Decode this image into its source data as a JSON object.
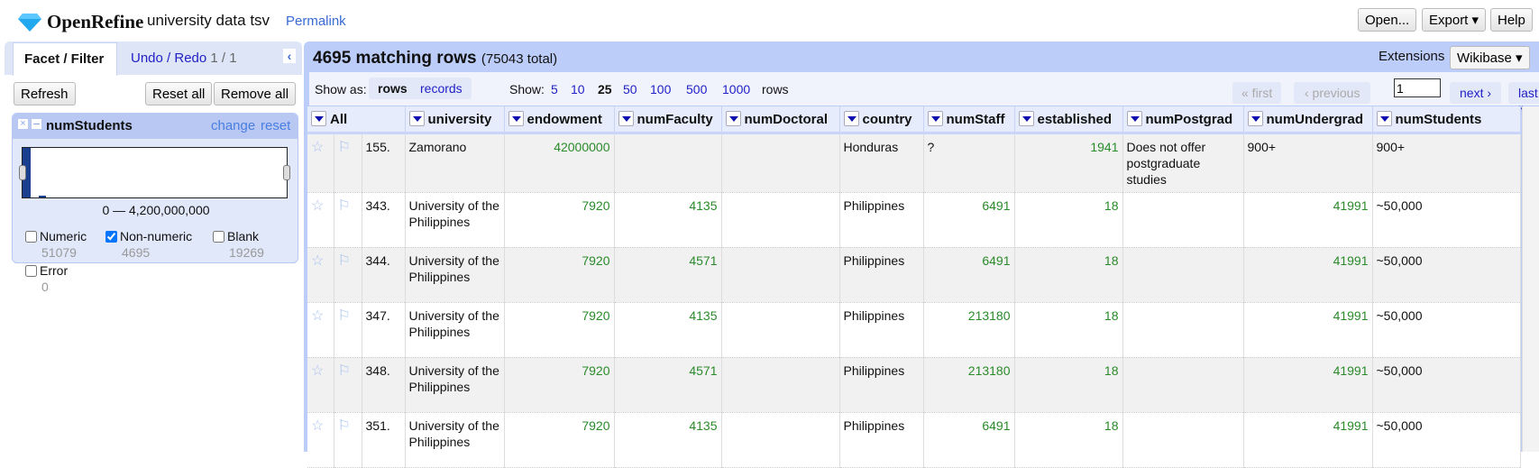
{
  "app": {
    "name": "OpenRefine",
    "project": "university data tsv",
    "permalink": "Permalink"
  },
  "top_buttons": {
    "open": "Open...",
    "export": "Export ▾",
    "help": "Help"
  },
  "left": {
    "tab_facet": "Facet / Filter",
    "tab_undo": "Undo / Redo",
    "undo_count": "1 / 1",
    "refresh": "Refresh",
    "reset_all": "Reset all",
    "remove_all": "Remove all"
  },
  "facet": {
    "title": "numStudents",
    "change": "change",
    "reset": "reset",
    "range": "0 — 4,200,000,000",
    "options": [
      {
        "label": "Numeric",
        "count": "51079",
        "checked": false
      },
      {
        "label": "Non-numeric",
        "count": "4695",
        "checked": true
      },
      {
        "label": "Blank",
        "count": "19269",
        "checked": false
      },
      {
        "label": "Error",
        "count": "0",
        "checked": false
      }
    ]
  },
  "summary": {
    "matching": "4695 matching rows",
    "total": "(75043 total)"
  },
  "extensions": {
    "label": "Extensions",
    "button": "Wikibase ▾"
  },
  "toolbar": {
    "show_as": "Show as:",
    "rows": "rows",
    "records": "records",
    "show": "Show:",
    "sizes": [
      "5",
      "10",
      "25",
      "50",
      "100",
      "500",
      "1000"
    ],
    "selected_size": "25",
    "rows_suffix": "rows",
    "first": "« first",
    "previous": "‹ previous",
    "page": "1",
    "next": "next ›",
    "last": "last »"
  },
  "columns": [
    "All",
    "university",
    "endowment",
    "numFaculty",
    "numDoctoral",
    "country",
    "numStaff",
    "established",
    "numPostgrad",
    "numUndergrad",
    "numStudents"
  ],
  "rows": [
    {
      "idx": "155.",
      "cells": [
        "Zamorano",
        "42000000",
        "",
        "",
        "Honduras",
        "?",
        "1941",
        "Does not offer postgraduate studies",
        "900+",
        "900+"
      ]
    },
    {
      "idx": "343.",
      "cells": [
        "University of the Philippines",
        "7920",
        "4135",
        "",
        "Philippines",
        "6491",
        "18",
        "",
        "41991",
        "~50,000"
      ]
    },
    {
      "idx": "344.",
      "cells": [
        "University of the Philippines",
        "7920",
        "4571",
        "",
        "Philippines",
        "6491",
        "18",
        "",
        "41991",
        "~50,000"
      ]
    },
    {
      "idx": "347.",
      "cells": [
        "University of the Philippines",
        "7920",
        "4135",
        "",
        "Philippines",
        "213180",
        "18",
        "",
        "41991",
        "~50,000"
      ]
    },
    {
      "idx": "348.",
      "cells": [
        "University of the Philippines",
        "7920",
        "4571",
        "",
        "Philippines",
        "213180",
        "18",
        "",
        "41991",
        "~50,000"
      ]
    },
    {
      "idx": "351.",
      "cells": [
        "University of the Philippines",
        "7920",
        "4135",
        "",
        "Philippines",
        "6491",
        "18",
        "",
        "41991",
        "~50,000"
      ]
    }
  ]
}
